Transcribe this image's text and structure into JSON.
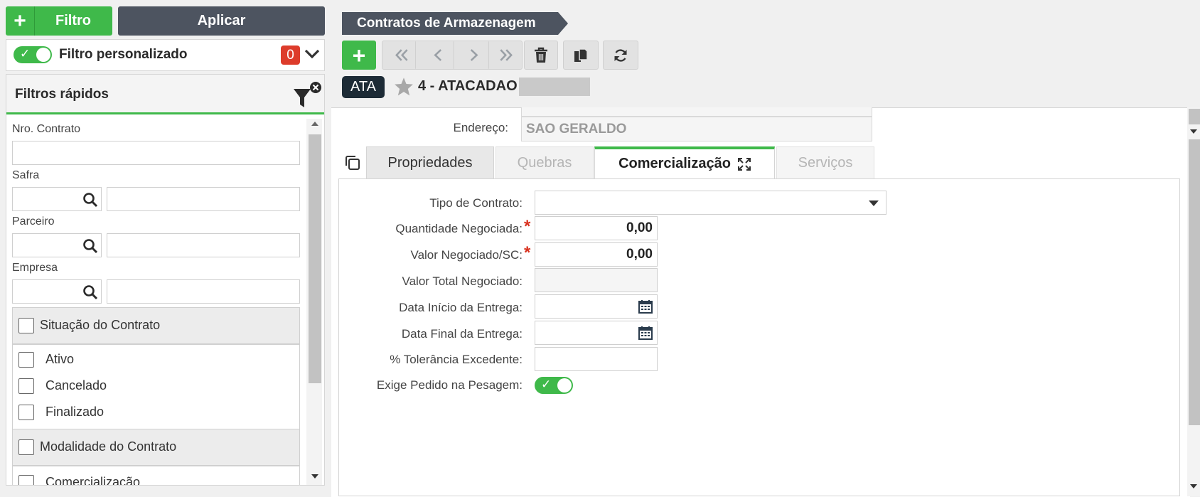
{
  "filter_bar": {
    "add_label": "Filtro",
    "apply_label": "Aplicar",
    "custom_filter_label": "Filtro personalizado",
    "custom_filter_count": "0",
    "custom_filter_enabled": true
  },
  "quick_filters": {
    "title": "Filtros rápidos",
    "fields": [
      {
        "label": "Nro. Contrato",
        "value": ""
      },
      {
        "label": "Safra",
        "code": "",
        "description": ""
      },
      {
        "label": "Parceiro",
        "code": "",
        "description": ""
      },
      {
        "label": "Empresa",
        "code": "",
        "description": ""
      }
    ],
    "groups": [
      {
        "title": "Situação do Contrato",
        "options": [
          "Ativo",
          "Cancelado",
          "Finalizado"
        ]
      },
      {
        "title": "Modalidade do Contrato",
        "options": [
          "Comercialização"
        ]
      }
    ]
  },
  "header": {
    "breadcrumb": "Contratos de Armazenagem",
    "entity_badge": "ATA",
    "entity_name": "4 - ATACADAO"
  },
  "form": {
    "address_label": "Endereço:",
    "address_value": "SAO GERALDO",
    "tabs": [
      {
        "label": "Propriedades",
        "state": "inactive"
      },
      {
        "label": "Quebras",
        "state": "disabled"
      },
      {
        "label": "Comercialização",
        "state": "active"
      },
      {
        "label": "Serviços",
        "state": "disabled"
      }
    ],
    "fields": {
      "tipo_contrato": {
        "label": "Tipo de Contrato:",
        "value": ""
      },
      "quantidade": {
        "label": "Quantidade Negociada:",
        "value": "0,00"
      },
      "valor_sc": {
        "label": "Valor Negociado/SC:",
        "value": "0,00"
      },
      "valor_total": {
        "label": "Valor Total Negociado:",
        "value": ""
      },
      "data_inicio": {
        "label": "Data Início da Entrega:",
        "value": ""
      },
      "data_final": {
        "label": "Data Final da Entrega:",
        "value": ""
      },
      "tolerancia": {
        "label": "% Tolerância Excedente:",
        "value": ""
      },
      "exige_pedido": {
        "label": "Exige Pedido na Pesagem:",
        "enabled": true
      }
    }
  },
  "colors": {
    "accent": "#3fb94a",
    "dark_button": "#4d5460",
    "badge": "#dd3c2b",
    "breadcrumb": "#4d5460"
  }
}
